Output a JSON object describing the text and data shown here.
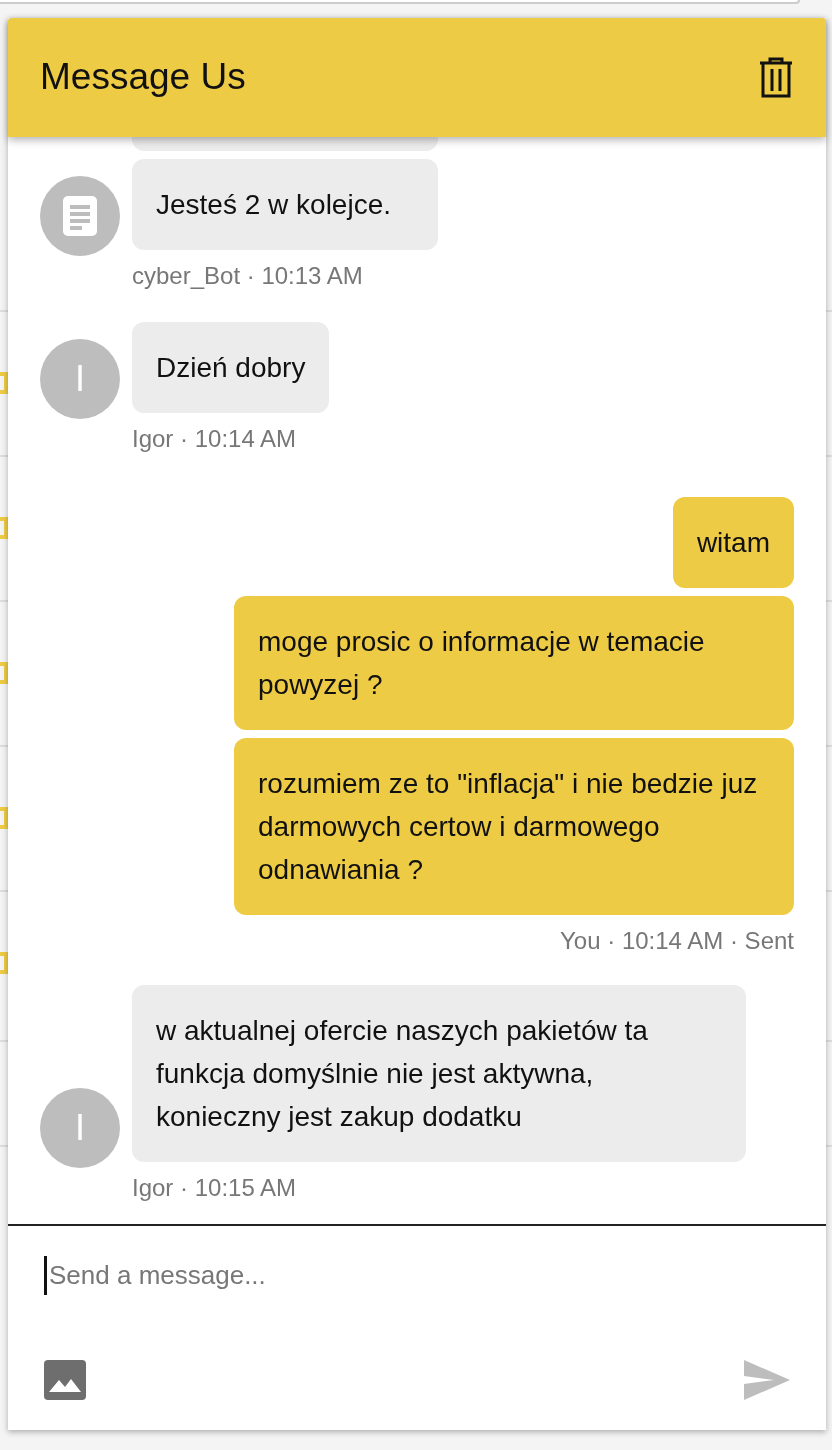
{
  "header": {
    "title": "Message Us"
  },
  "groups": [
    {
      "outgoing": false,
      "avatar": {
        "kind": "icon"
      },
      "bubbles": [
        {
          "kind": "fragment"
        },
        {
          "text": "Jesteś 2 w kolejce.",
          "kind": "text"
        }
      ],
      "meta": "cyber_Bot · 10:13 AM"
    },
    {
      "outgoing": false,
      "avatar": {
        "kind": "letter",
        "letter": "I"
      },
      "bubbles": [
        {
          "text": "Dzień dobry",
          "kind": "text"
        }
      ],
      "meta": "Igor · 10:14 AM"
    },
    {
      "outgoing": true,
      "bubbles": [
        {
          "text": "witam",
          "kind": "text"
        },
        {
          "text": "moge prosic o informacje w temacie powyzej ?",
          "kind": "text"
        },
        {
          "text": "rozumiem ze to \"inflacja\" i nie bedzie juz darmowych certow i darmowego odnawiania ?",
          "kind": "text"
        }
      ],
      "meta": "You · 10:14 AM · Sent"
    },
    {
      "outgoing": false,
      "avatar": {
        "kind": "letter",
        "letter": "I"
      },
      "bubbles": [
        {
          "text": "w aktualnej ofercie naszych pakietów ta funkcja domyślnie nie jest aktywna, konieczny jest zakup dodatku",
          "kind": "text"
        }
      ],
      "meta": "Igor · 10:15 AM"
    }
  ],
  "composer": {
    "placeholder": "Send a message..."
  }
}
